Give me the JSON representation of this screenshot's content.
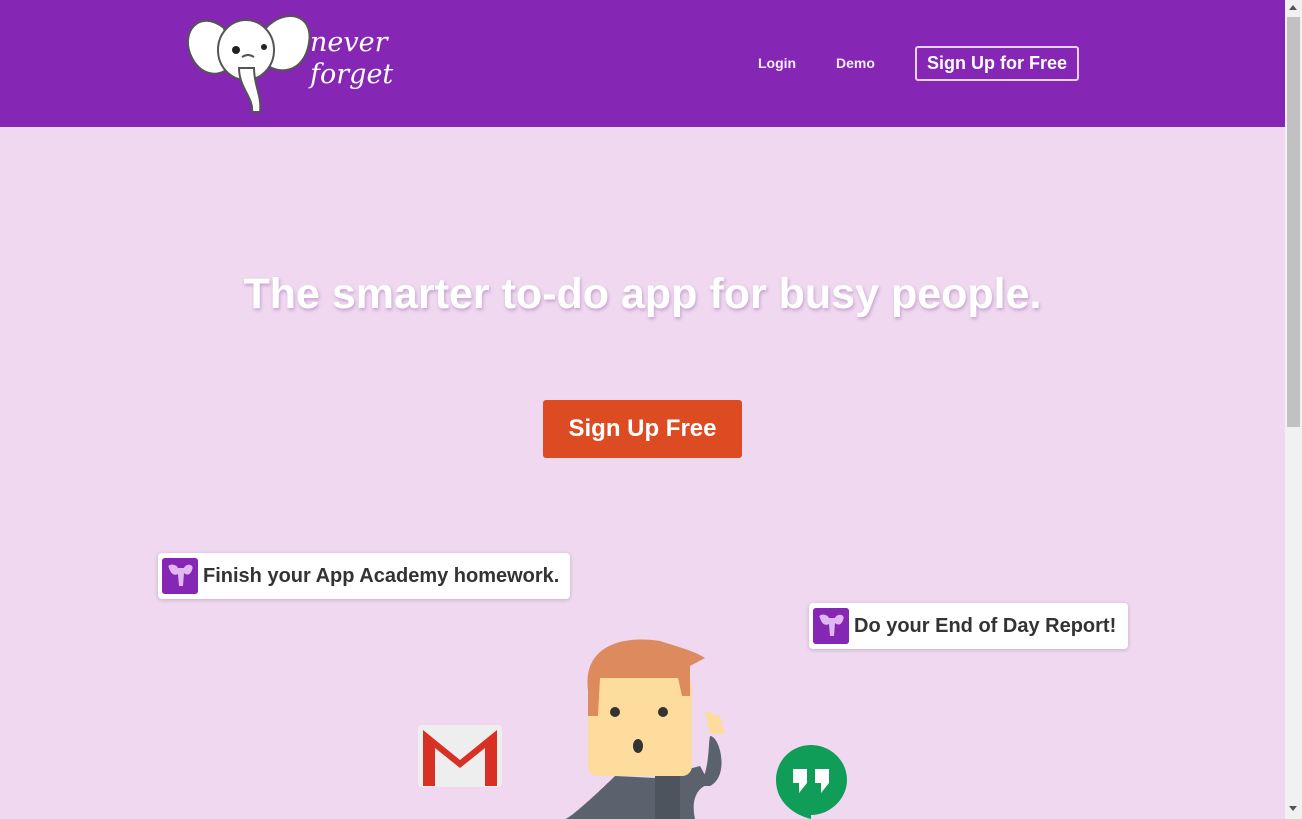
{
  "brand": {
    "line1": "never",
    "line2": "forget"
  },
  "nav": {
    "login": "Login",
    "demo": "Demo",
    "signup": "Sign Up for Free"
  },
  "hero": {
    "title": "The smarter to-do app for busy people.",
    "cta": "Sign Up Free"
  },
  "notes": [
    {
      "text": "Finish your App Academy homework."
    },
    {
      "text": "Do your End of Day Report!"
    }
  ],
  "icons": {
    "logo": "elephant-logo-icon",
    "note": "elephant-badge-icon",
    "gmail": "gmail-icon",
    "hangouts": "hangouts-icon",
    "person": "person-illustration"
  },
  "colors": {
    "header": "#8526b5",
    "background": "#efd8f0",
    "cta": "#dd4b22"
  }
}
